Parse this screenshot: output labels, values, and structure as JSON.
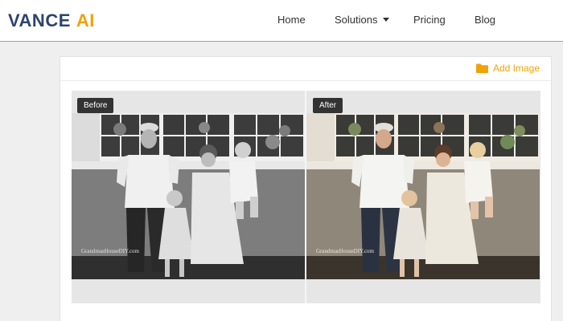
{
  "header": {
    "logo_main": "VANCE",
    "logo_accent": "AI",
    "nav": {
      "home": "Home",
      "solutions": "Solutions",
      "pricing": "Pricing",
      "blog": "Blog"
    }
  },
  "toolbar": {
    "add_image_label": "Add Image",
    "add_image_icon": "folder-icon"
  },
  "comparison": {
    "before_label": "Before",
    "after_label": "After",
    "watermark": "GrandmasHouseDIY.com"
  },
  "colors": {
    "brand_navy": "#2d4370",
    "brand_orange": "#f0a20a"
  }
}
